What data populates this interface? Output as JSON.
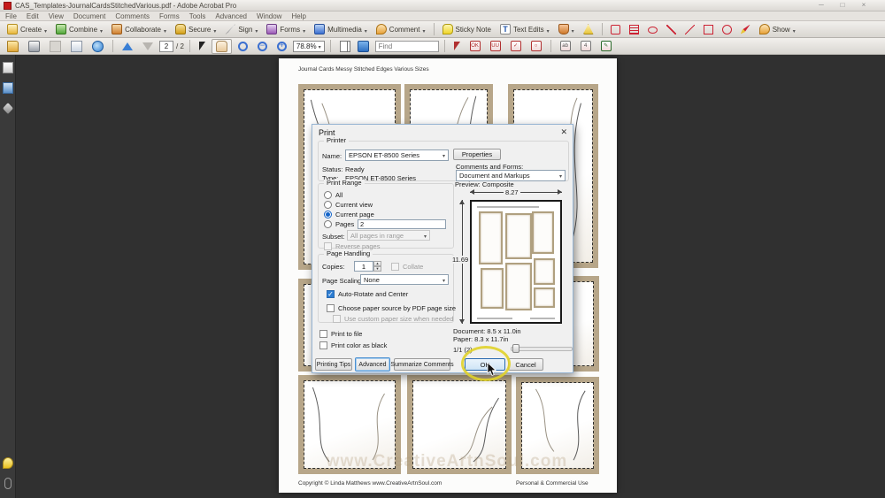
{
  "colors": {
    "canvas_bg": "#303030",
    "dialog_bg": "#f0f0f0",
    "selection_blue": "#2d7dd2",
    "highlight_yellow": "#e0d229",
    "card_border_tan": "#b7a689",
    "acrobat_red": "#c61a1a"
  },
  "window": {
    "title": "CAS_Templates-JournalCardsStitchedVarious.pdf - Adobe Acrobat Pro",
    "controls": [
      "minimize",
      "maximize",
      "close"
    ]
  },
  "menu": {
    "items": [
      "File",
      "Edit",
      "View",
      "Document",
      "Comments",
      "Forms",
      "Tools",
      "Advanced",
      "Window",
      "Help"
    ]
  },
  "toolbar_main": {
    "buttons": [
      "Create",
      "Combine",
      "Collaborate",
      "Secure",
      "Sign",
      "Forms",
      "Multimedia",
      "Comment"
    ],
    "sticky_note": "Sticky Note",
    "text_edits": "Text Edits",
    "show": "Show",
    "icons": [
      "create-icon",
      "combine-icon",
      "collaborate-icon",
      "secure-icon",
      "sign-icon",
      "forms-icon",
      "multimedia-icon",
      "comment-icon",
      "sticky-note-icon",
      "text-edits-icon",
      "stamp-icon",
      "approved-stamp-icon",
      "callout-tool-icon",
      "text-box-tool-icon",
      "cloud-tool-icon",
      "arrow-tool-icon",
      "line-tool-icon",
      "rectangle-tool-icon",
      "oval-tool-icon",
      "pencil-tool-icon"
    ]
  },
  "toolbar_nav": {
    "page_current": "2",
    "page_total": "/ 2",
    "zoom_level": "78.8%",
    "find_placeholder": "Find",
    "icons": [
      "open-icon",
      "print-icon",
      "save-icon",
      "email-icon",
      "web-icon",
      "previous-page-icon",
      "next-page-icon",
      "select-tool-icon",
      "hand-tool-icon",
      "zoom-marquee-icon",
      "zoom-out-icon",
      "zoom-in-icon",
      "page-layout-icon",
      "fit-page-icon",
      "select-object-tool-icon",
      "button-field-tool-icon",
      "barcode-field-tool-icon",
      "checkbox-field-tool-icon",
      "radio-field-tool-icon",
      "text-field-tool-icon",
      "digital-signature-tool-icon"
    ]
  },
  "sidebar": {
    "icons": [
      "pages-panel-icon",
      "bookmarks-panel-icon",
      "layers-panel-icon",
      "comments-panel-icon",
      "attachments-panel-icon"
    ]
  },
  "document": {
    "title": "Journal Cards Messy Stitched Edges Various Sizes",
    "copyright": "Copyright © Linda Matthews www.CreativeArtnSoul.com",
    "license": "Personal & Commercial Use",
    "watermark": "www.CreativeArtnSoul.com"
  },
  "print_dialog": {
    "title": "Print",
    "close_icon": "close-icon",
    "printer": {
      "legend": "Printer",
      "name_label": "Name:",
      "name_value": "EPSON ET-8500 Series",
      "properties_button": "Properties",
      "status_label": "Status:",
      "status_value": "Ready",
      "type_label": "Type:",
      "type_value": "EPSON ET-8500 Series",
      "comments_forms_label": "Comments and Forms:",
      "comments_forms_value": "Document and Markups"
    },
    "print_range": {
      "legend": "Print Range",
      "all": "All",
      "current_view": "Current view",
      "current_page": "Current page",
      "selected_option": "Current page",
      "pages": "Pages",
      "pages_value": "2",
      "subset_label": "Subset:",
      "subset_value": "All pages in range",
      "reverse_pages": "Reverse pages"
    },
    "page_handling": {
      "legend": "Page Handling",
      "copies_label": "Copies:",
      "copies_value": "1",
      "collate": "Collate",
      "page_scaling_label": "Page Scaling:",
      "page_scaling_value": "None",
      "auto_rotate": "Auto-Rotate and Center",
      "auto_rotate_checked": true,
      "choose_paper_source": "Choose paper source by PDF page size",
      "use_custom_paper": "Use custom paper size when needed"
    },
    "options": {
      "print_to_file": "Print to file",
      "print_color_black": "Print color as black"
    },
    "buttons": {
      "printing_tips": "Printing Tips",
      "advanced": "Advanced",
      "summarize_comments": "Summarize Comments",
      "ok": "OK",
      "cancel": "Cancel"
    },
    "preview": {
      "label": "Preview: Composite",
      "width_in": "8.27",
      "height_in": "11.69",
      "document_size": "Document: 8.5 x 11.0in",
      "paper_size": "Paper: 8.3 x 11.7in",
      "page_indicator": "1/1 (2)"
    }
  }
}
